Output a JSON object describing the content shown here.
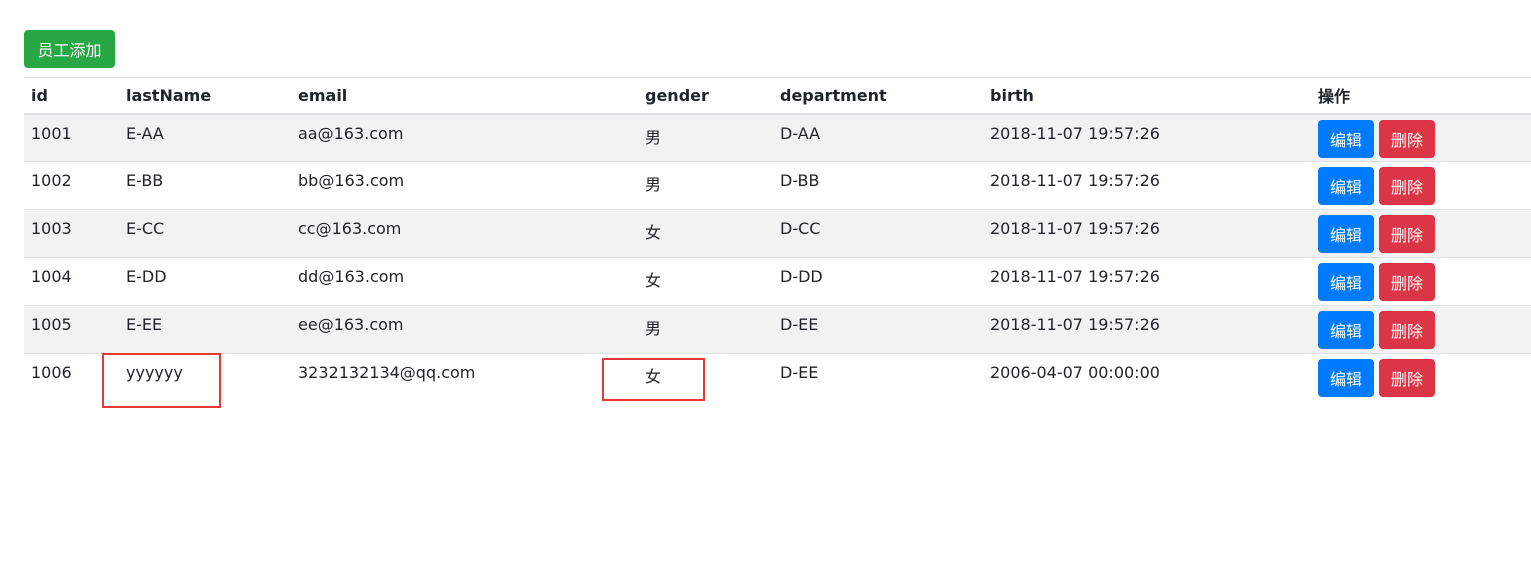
{
  "toolbar": {
    "add_label": "员工添加",
    "add_color": "#28a745"
  },
  "table": {
    "headers": [
      "id",
      "lastName",
      "email",
      "gender",
      "department",
      "birth",
      "操作"
    ],
    "rows": [
      [
        "1001",
        "E-AA",
        "aa@163.com",
        "男",
        "D-AA",
        "2018-11-07 19:57:26"
      ],
      [
        "1002",
        "E-BB",
        "bb@163.com",
        "男",
        "D-BB",
        "2018-11-07 19:57:26"
      ],
      [
        "1003",
        "E-CC",
        "cc@163.com",
        "女",
        "D-CC",
        "2018-11-07 19:57:26"
      ],
      [
        "1004",
        "E-DD",
        "dd@163.com",
        "女",
        "D-DD",
        "2018-11-07 19:57:26"
      ],
      [
        "1005",
        "E-EE",
        "ee@163.com",
        "男",
        "D-EE",
        "2018-11-07 19:57:26"
      ],
      [
        "1006",
        "yyyyyy",
        "3232132134@qq.com",
        "女",
        "D-EE",
        "2006-04-07 00:00:00"
      ]
    ],
    "edit_label": "编辑",
    "delete_label": "删除",
    "edit_color": "#007bff",
    "delete_color": "#dc3545"
  },
  "annotations": {
    "highlight_color": "#e53935"
  }
}
